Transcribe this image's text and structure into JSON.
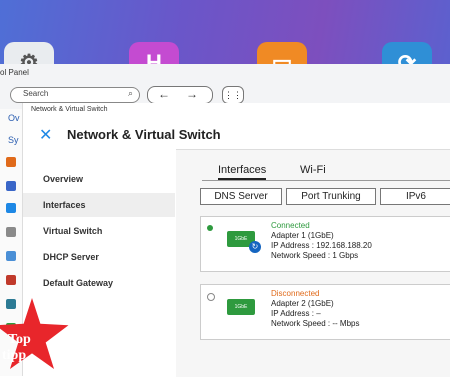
{
  "control_panel": {
    "title": "ol Panel",
    "search_placeholder": "Search",
    "nav_back": "←",
    "nav_forward": "→",
    "grid_icon": "grid-icon",
    "rail_labels": [
      "Ov",
      "Sy"
    ]
  },
  "inner": {
    "breadcrumb": "Network & Virtual Switch",
    "app_name": "Network & Virtual Switch"
  },
  "menu": {
    "items": [
      {
        "label": "Overview"
      },
      {
        "label": "Interfaces"
      },
      {
        "label": "Virtual Switch"
      },
      {
        "label": "DHCP Server"
      },
      {
        "label": "Default Gateway"
      }
    ],
    "active_index": 1
  },
  "tabs": [
    {
      "label": "Interfaces"
    },
    {
      "label": "Wi-Fi"
    }
  ],
  "buttons": {
    "dns": "DNS Server",
    "trunking": "Port Trunking",
    "ipv6": "IPv6"
  },
  "adapters": [
    {
      "status": "Connected",
      "status_color": "#2e9a3e",
      "name": "Adapter 1 (1GbE)",
      "ip": "IP Address : 192.168.188.20",
      "speed": "Network Speed : 1 Gbps",
      "nic_label": "1GbE"
    },
    {
      "status": "Disconnected",
      "status_color": "#e06a1a",
      "name": "Adapter 2 (1GbE)",
      "ip": "IP Address : –",
      "speed": "Network Speed : -- Mbps",
      "nic_label": "1GbE"
    }
  ],
  "badge": {
    "line1": "Top",
    "line2": "tipp"
  }
}
